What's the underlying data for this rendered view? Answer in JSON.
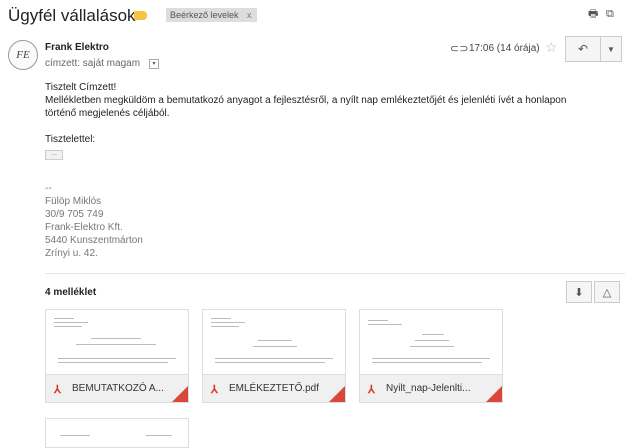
{
  "header": {
    "subject": "Ügyfél vállalások",
    "chip_label": "Beérkező levelek",
    "chip_close": "x",
    "print_icon": "print-icon",
    "newwindow_icon": "new-window-icon"
  },
  "message": {
    "avatar_text": "FE",
    "sender": "Frank Elektro",
    "to": "címzett: saját magam",
    "time": "17:06 (14 órája)",
    "body_lines": [
      "Tisztelt Címzett!",
      "Mellékletben megküldöm a bemutatkozó anyagot a fejlesztésről, a nyílt nap emlékeztetőjét és jelenléti ívét a honlapon",
      "történő megjelenés céljából.",
      "",
      "Tisztelettel:"
    ],
    "ellipsis": "...",
    "signature": [
      "--",
      "Fülöp Miklós",
      "30/9 705 749",
      "Frank-Elektro Kft.",
      "5440 Kunszentmárton",
      "Zrínyi u. 42."
    ]
  },
  "attachments": {
    "title": "4 melléklet",
    "files": [
      {
        "name": "BEMUTATKOZÓ A..."
      },
      {
        "name": "EMLÉKEZTETŐ.pdf"
      },
      {
        "name": "Nyilt_nap-Jelenlti..."
      }
    ]
  }
}
